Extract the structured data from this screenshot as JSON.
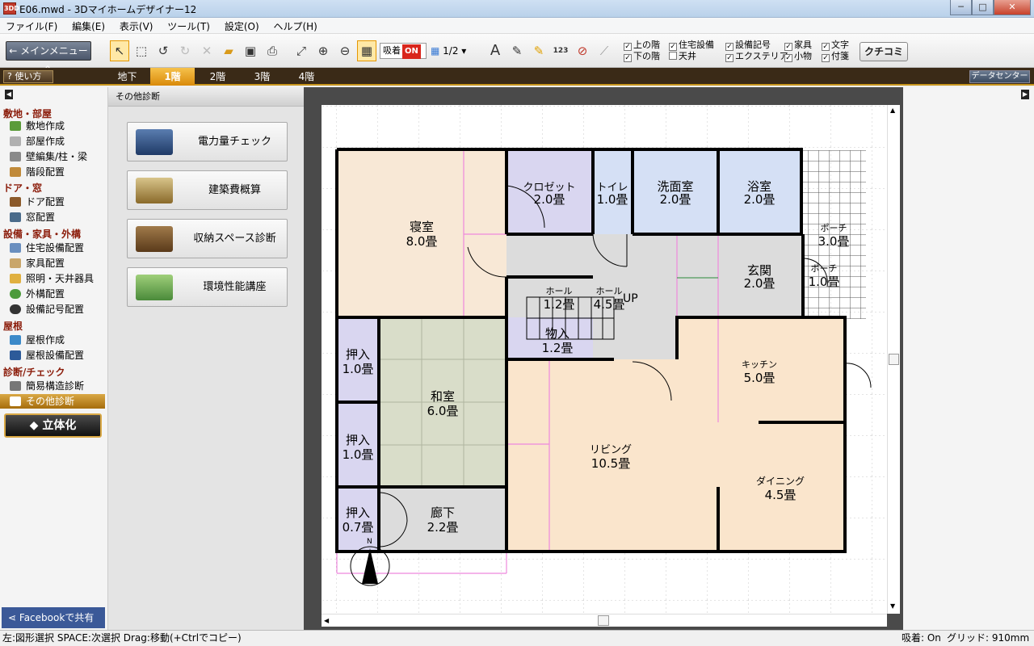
{
  "window": {
    "title": "E06.mwd - 3Dマイホームデザイナー12",
    "icon": "3DD",
    "min": "─",
    "max": "□",
    "close": "✕"
  },
  "menu": [
    "ファイル(F)",
    "編集(E)",
    "表示(V)",
    "ツール(T)",
    "設定(O)",
    "ヘルプ(H)"
  ],
  "toolbar": {
    "main_menu": "メインメニューへ",
    "magnet_label": "吸着",
    "magnet_state": "ON",
    "scale": "1/2",
    "text_tool": "A",
    "num_tool": "123"
  },
  "display_options": [
    {
      "label": "上の階",
      "checked": true
    },
    {
      "label": "下の階",
      "checked": true
    },
    {
      "label": "住宅設備",
      "checked": true
    },
    {
      "label": "天井",
      "checked": false
    },
    {
      "label": "設備記号",
      "checked": true
    },
    {
      "label": "エクステリア",
      "checked": true
    },
    {
      "label": "家具",
      "checked": true
    },
    {
      "label": "小物",
      "checked": true
    },
    {
      "label": "文字",
      "checked": true
    },
    {
      "label": "付箋",
      "checked": true
    }
  ],
  "kuchikomi": "クチコミ",
  "floorbar": {
    "howto": "使い方",
    "tabs": [
      "地下",
      "1階",
      "2階",
      "3階",
      "4階"
    ],
    "active": "1階",
    "data_center": "データセンター"
  },
  "sidebar": {
    "sections": [
      {
        "title": "敷地・部屋",
        "items": [
          "敷地作成",
          "部屋作成",
          "壁編集/柱・梁",
          "階段配置"
        ]
      },
      {
        "title": "ドア・窓",
        "items": [
          "ドア配置",
          "窓配置"
        ]
      },
      {
        "title": "設備・家具・外構",
        "items": [
          "住宅設備配置",
          "家具配置",
          "照明・天井器具",
          "外構配置",
          "設備記号配置"
        ]
      },
      {
        "title": "屋根",
        "items": [
          "屋根作成",
          "屋根設備配置"
        ]
      },
      {
        "title": "診断/チェック",
        "items": [
          "簡易構造診断",
          "その他診断"
        ]
      }
    ],
    "active_item": "その他診断",
    "rittaika": "立体化",
    "facebook": "Facebookで共有"
  },
  "diagnosis_panel": {
    "title": "その他診断",
    "buttons": [
      "電力量チェック",
      "建築費概算",
      "収納スペース診断",
      "環境性能講座"
    ]
  },
  "rooms": [
    {
      "id": "shinshitsu",
      "name": "寝室",
      "size": "8.0畳"
    },
    {
      "id": "closet",
      "name": "クロゼット",
      "size": "2.0畳"
    },
    {
      "id": "toilet",
      "name": "トイレ",
      "size": "1.0畳"
    },
    {
      "id": "senmen",
      "name": "洗面室",
      "size": "2.0畳"
    },
    {
      "id": "yokushitsu",
      "name": "浴室",
      "size": "2.0畳"
    },
    {
      "id": "porch1",
      "name": "ポーチ",
      "size": "3.0畳"
    },
    {
      "id": "genkan",
      "name": "玄関",
      "size": "2.0畳"
    },
    {
      "id": "porch2",
      "name": "ポーチ",
      "size": "1.0畳"
    },
    {
      "id": "hall1",
      "name": "ホール",
      "size": "1.2畳"
    },
    {
      "id": "hall2",
      "name": "ホール",
      "size": "4.5畳"
    },
    {
      "id": "monoire",
      "name": "物入",
      "size": "1.2畳"
    },
    {
      "id": "oshiire1",
      "name": "押入",
      "size": "1.0畳"
    },
    {
      "id": "washitsu",
      "name": "和室",
      "size": "6.0畳"
    },
    {
      "id": "kitchen",
      "name": "キッチン",
      "size": "5.0畳"
    },
    {
      "id": "oshiire2",
      "name": "押入",
      "size": "1.0畳"
    },
    {
      "id": "living",
      "name": "リビング",
      "size": "10.5畳"
    },
    {
      "id": "dining",
      "name": "ダイニング",
      "size": "4.5畳"
    },
    {
      "id": "oshiire3",
      "name": "押入",
      "size": "0.7畳"
    },
    {
      "id": "rouka",
      "name": "廊下",
      "size": "2.2畳"
    }
  ],
  "plan_labels": {
    "stairs_up": "UP",
    "north": "N"
  },
  "status": {
    "left": "左:図形選択 SPACE:次選択 Drag:移動(+Ctrlでコピー)",
    "magnet": "吸着: On",
    "grid": "グリッド: 910mm"
  },
  "colors": {
    "bedroom": "#f8e8d6",
    "closet": "#d9d6f0",
    "water": "#d5e0f5",
    "hall": "#dcdcdc",
    "washitsu": "#d9ddc9",
    "living": "#fae5cc",
    "wall": "#000000",
    "guide": "#ee88dd"
  }
}
